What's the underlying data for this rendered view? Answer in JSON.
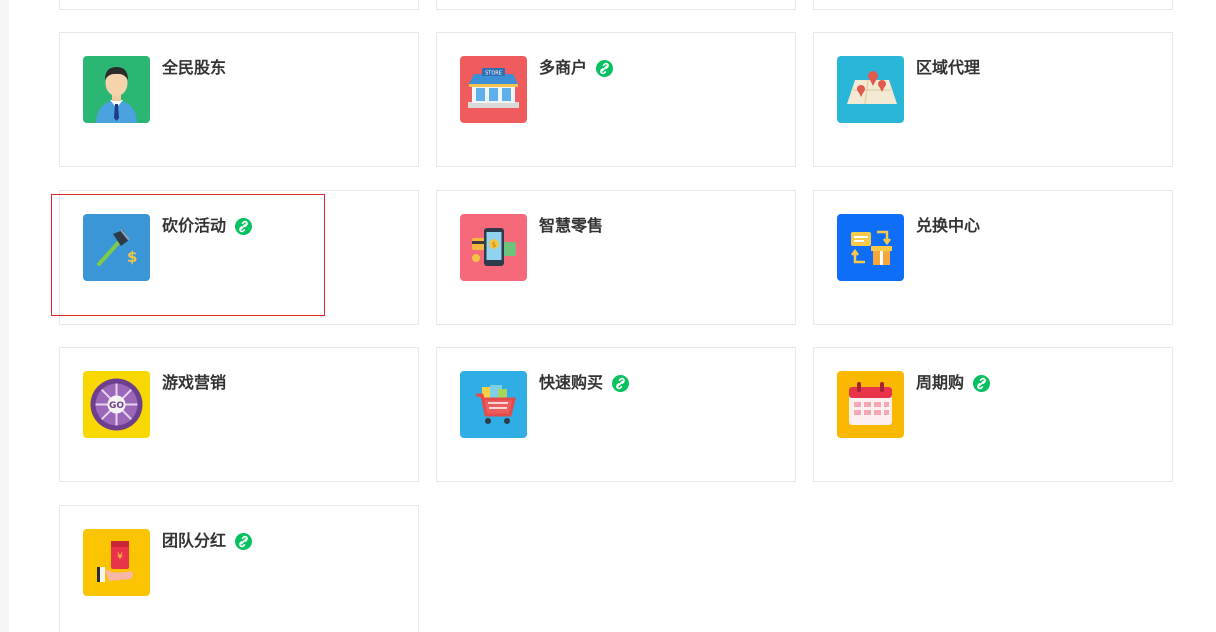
{
  "colors": {
    "card_border": "#e9e9e9",
    "badge_green": "#07c160",
    "highlight_red": "#e0282e"
  },
  "plugins": [
    {
      "title": "全民股东",
      "icon": "shareholder-person-icon",
      "icon_bg": "#2bb673",
      "badge": false
    },
    {
      "title": "多商户",
      "icon": "store-icon",
      "icon_bg": "#f05b5e",
      "badge": true
    },
    {
      "title": "区域代理",
      "icon": "map-pins-icon",
      "icon_bg": "#29b6d8",
      "badge": false
    },
    {
      "title": "砍价活动",
      "icon": "axe-icon",
      "icon_bg": "#3a96d6",
      "badge": true
    },
    {
      "title": "智慧零售",
      "icon": "smart-retail-phone-icon",
      "icon_bg": "#f5697a",
      "badge": false
    },
    {
      "title": "兑换中心",
      "icon": "exchange-gift-icon",
      "icon_bg": "#0f6ef7",
      "badge": false
    },
    {
      "title": "游戏营销",
      "icon": "roulette-wheel-icon",
      "icon_bg": "#f8d800",
      "badge": false
    },
    {
      "title": "快速购买",
      "icon": "shopping-cart-icon",
      "icon_bg": "#2eaee5",
      "badge": true
    },
    {
      "title": "周期购",
      "icon": "calendar-icon",
      "icon_bg": "#fbb800",
      "badge": true
    },
    {
      "title": "团队分红",
      "icon": "red-envelope-icon",
      "icon_bg": "#fbc400",
      "badge": true
    }
  ]
}
